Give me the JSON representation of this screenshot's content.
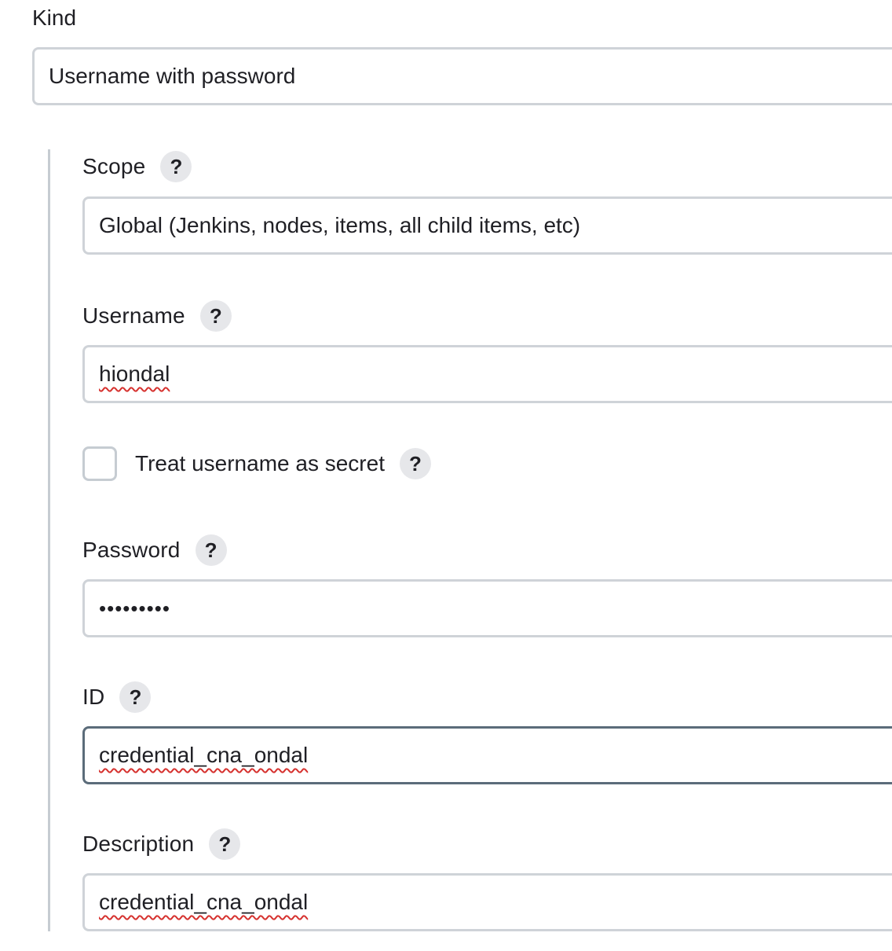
{
  "kind": {
    "label": "Kind",
    "value": "Username with password"
  },
  "scope": {
    "label": "Scope",
    "help": "?",
    "value": "Global (Jenkins, nodes, items, all child items, etc)"
  },
  "username": {
    "label": "Username",
    "help": "?",
    "value": "hiondal"
  },
  "treat_secret": {
    "label": "Treat username as secret",
    "help": "?",
    "checked": false
  },
  "password": {
    "label": "Password",
    "help": "?",
    "masked_value": "•••••••••"
  },
  "id": {
    "label": "ID",
    "help": "?",
    "value": "credential_cna_ondal"
  },
  "description": {
    "label": "Description",
    "help": "?",
    "value": "credential_cna_ondal"
  }
}
